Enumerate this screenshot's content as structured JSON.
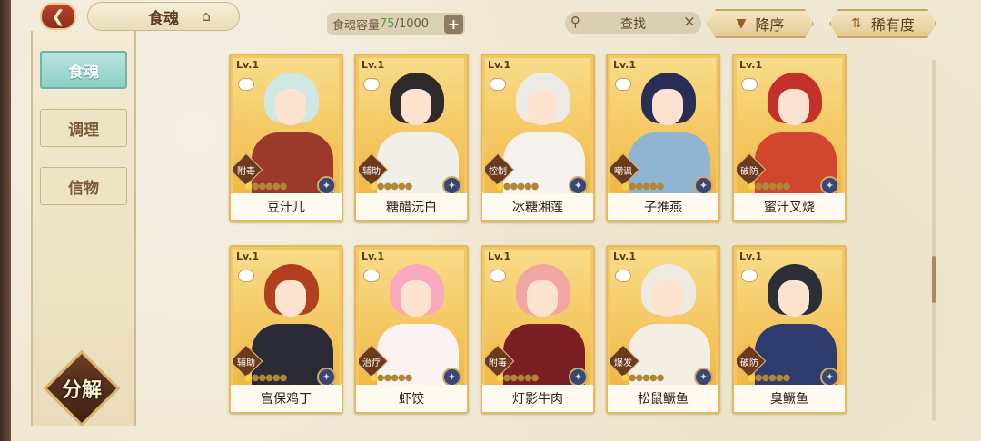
{
  "header": {
    "back_icon": "back-arrow-icon",
    "title": "食魂",
    "home_icon": "home-icon",
    "capacity": {
      "label": "食魂容量",
      "used": "75",
      "total": "/1000",
      "add_symbol": "+"
    },
    "search": {
      "placeholder": "查找",
      "clear_symbol": "×"
    },
    "sort_order": {
      "label": "降序",
      "icon": "triangle-down-icon"
    },
    "sort_by": {
      "label": "稀有度",
      "icon": "sort-icon"
    }
  },
  "sidebar": {
    "items": [
      {
        "label": "食魂",
        "active": true
      },
      {
        "label": "调理",
        "active": false
      },
      {
        "label": "信物",
        "active": false
      }
    ],
    "decompose_label": "分解"
  },
  "scroll": {
    "position": 0.55
  },
  "cards": [
    {
      "level": "Lv.1",
      "name": "豆汁儿",
      "role": "附毒",
      "hair": "#cfe7e3",
      "outfit": "#9b3a2c"
    },
    {
      "level": "Lv.1",
      "name": "糖醋沅白",
      "role": "辅助",
      "hair": "#2f2a2a",
      "outfit": "#f1efe9"
    },
    {
      "level": "Lv.1",
      "name": "冰糖湘莲",
      "role": "控制",
      "hair": "#eceae4",
      "outfit": "#f4f2ee"
    },
    {
      "level": "Lv.1",
      "name": "子推燕",
      "role": "嘲讽",
      "hair": "#2a2d55",
      "outfit": "#8fb5d3"
    },
    {
      "level": "Lv.1",
      "name": "蜜汁叉烧",
      "role": "破防",
      "hair": "#c4302a",
      "outfit": "#d2452f"
    },
    {
      "level": "Lv.1",
      "name": "宫保鸡丁",
      "role": "辅助",
      "hair": "#b0401f",
      "outfit": "#2a2b37"
    },
    {
      "level": "Lv.1",
      "name": "虾饺",
      "role": "治疗",
      "hair": "#f7a9bd",
      "outfit": "#fbf3f3"
    },
    {
      "level": "Lv.1",
      "name": "灯影牛肉",
      "role": "附毒",
      "hair": "#f0a6a2",
      "outfit": "#7a1f24"
    },
    {
      "level": "Lv.1",
      "name": "松鼠鳜鱼",
      "role": "爆发",
      "hair": "#eee9e1",
      "outfit": "#f3efe5"
    },
    {
      "level": "Lv.1",
      "name": "臭鳜鱼",
      "role": "破防",
      "hair": "#2c2e3a",
      "outfit": "#2f3c6e"
    }
  ],
  "card_stars": "●●●●●",
  "card_gem_icon": "gem-icon",
  "card_badge_icon": "emblem-icon"
}
